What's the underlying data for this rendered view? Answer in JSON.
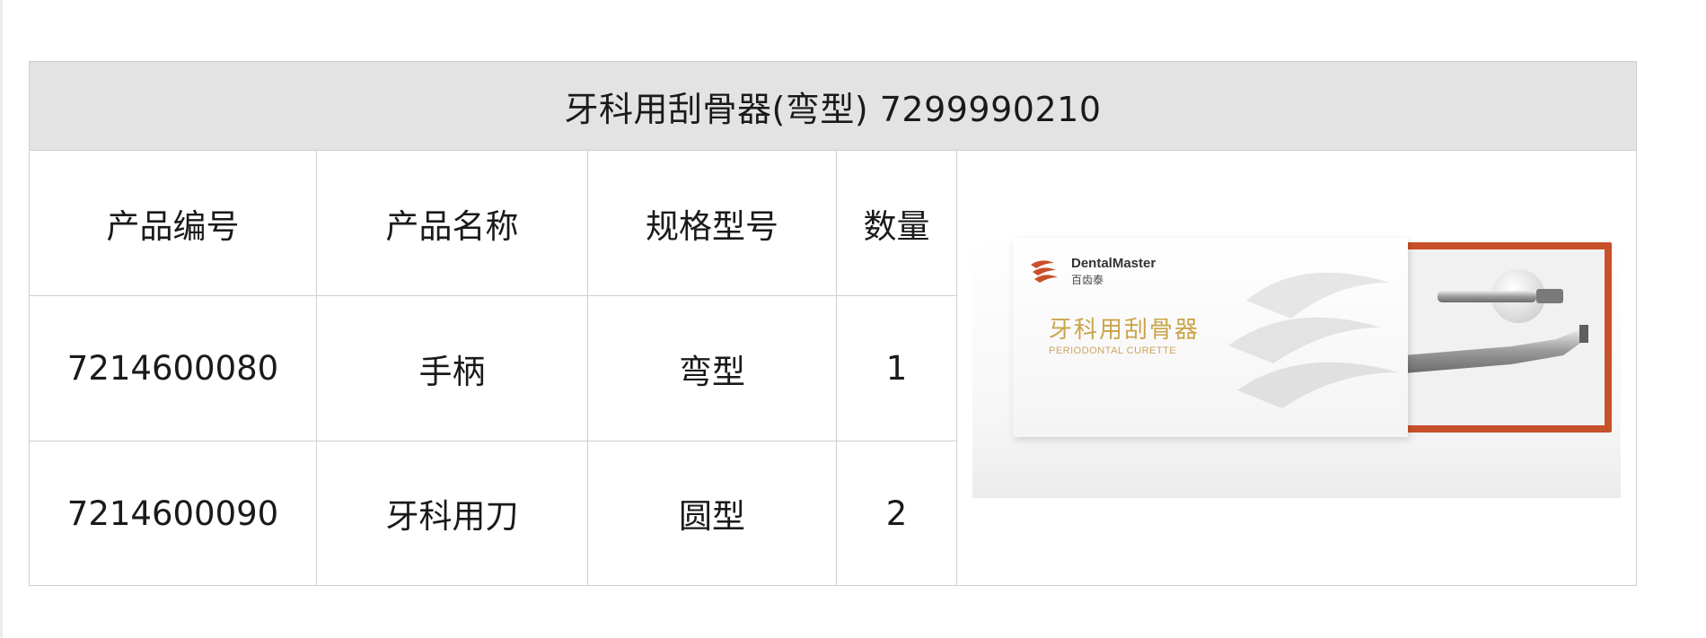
{
  "table": {
    "title": "牙科用刮骨器(弯型) 7299990210",
    "headers": [
      "产品编号",
      "产品名称",
      "规格型号",
      "数量"
    ],
    "rows": [
      [
        "7214600080",
        "手柄",
        "弯型",
        "1"
      ],
      [
        "7214600090",
        "牙科用刀",
        "圆型",
        "2"
      ]
    ]
  },
  "product_image": {
    "brand_name": "DentalMaster",
    "brand_sub": "百齿泰",
    "box_title": "牙科用刮骨器",
    "box_subtitle": "PERIODONTAL CURETTE",
    "tray_color": "#c8502a",
    "accent_gold": "#caa44a"
  }
}
